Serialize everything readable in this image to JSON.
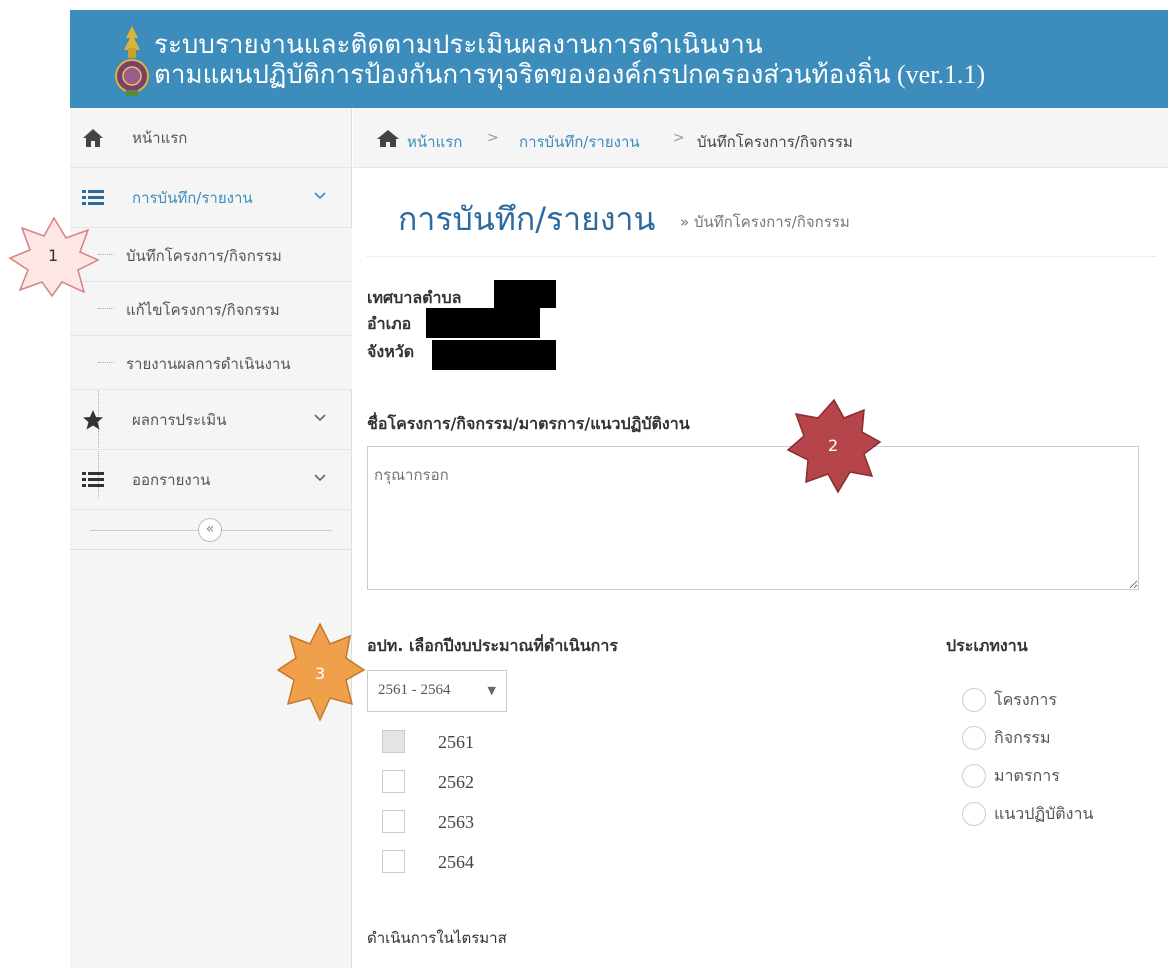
{
  "header": {
    "line1": "ระบบรายงานและติดตามประเมินผลงานการดำเนินงาน",
    "line2": "ตามแผนปฏิบัติการป้องกันการทุจริตขององค์กรปกครองส่วนท้องถิ่น (ver.1.1)"
  },
  "sidebar": {
    "home": "หน้าแรก",
    "record": "การบันทึก/รายงาน",
    "sub_items": [
      "บันทึกโครงการ/กิจกรรม",
      "แก้ไขโครงการ/กิจกรรม",
      "รายงานผลการดำเนินงาน"
    ],
    "evaluation": "ผลการประเมิน",
    "print": "ออกรายงาน",
    "collapse_glyph": "«"
  },
  "breadcrumb": {
    "items": [
      "หน้าแรก",
      "การบันทึก/รายงาน",
      "บันทึกโครงการ/กิจกรรม"
    ],
    "sep": ">"
  },
  "page": {
    "title": "การบันทึก/รายงาน",
    "subtitle": "» บันทึกโครงการ/กิจกรรม"
  },
  "info": {
    "municipality": "เทศบาลตำบล",
    "district": "อำเภอ",
    "province": "จังหวัด"
  },
  "form": {
    "project_label": "ชื่อโครงการ/กิจกรรม/มาตรการ/แนวปฏิบัติงาน",
    "project_placeholder": "กรุณากรอก",
    "year_label": "อปท. เลือกปีงบประมาณที่ดำเนินการ",
    "year_select": "2561 - 2564",
    "years": [
      "2561",
      "2562",
      "2563",
      "2564"
    ],
    "type_label": "ประเภทงาน",
    "types": [
      "โครงการ",
      "กิจกรรม",
      "มาตรการ",
      "แนวปฏิบัติงาน"
    ],
    "quarter_label": "ดำเนินการในไตรมาส"
  },
  "markers": [
    "1",
    "2",
    "3"
  ],
  "colors": {
    "header": "#3c8dbc",
    "title": "#2c6aa0",
    "link": "#3c8dbc",
    "marker1": "#fde6e6",
    "marker2": "#b5454a",
    "marker3": "#f0a04b"
  }
}
